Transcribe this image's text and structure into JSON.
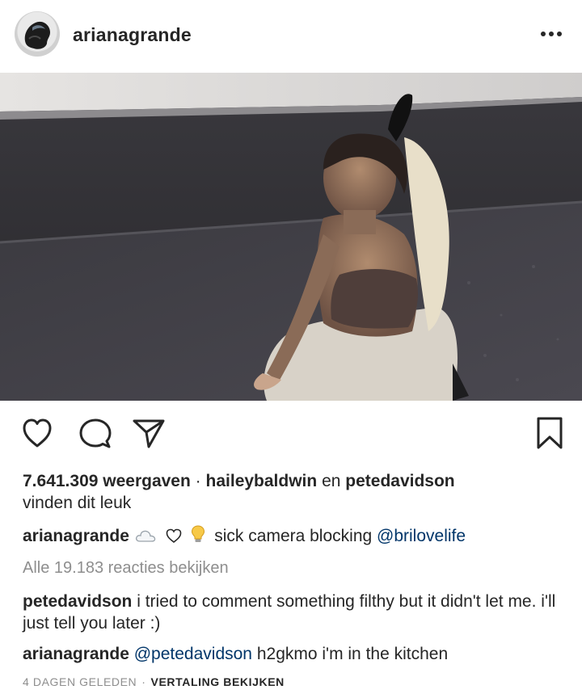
{
  "header": {
    "username": "arianagrande",
    "avatar_icon": "profile-photo",
    "more_icon": "more-horizontal-icon"
  },
  "media": {
    "type": "video-still"
  },
  "actions": {
    "like_icon": "heart-outline-icon",
    "comment_icon": "comment-bubble-icon",
    "share_icon": "paper-plane-icon",
    "save_icon": "bookmark-icon"
  },
  "stats": {
    "views": "7.641.309 weergaven",
    "separator": "·",
    "liker1": "haileybaldwin",
    "and_word": "en",
    "liker2": "petedavidson",
    "likes_suffix": "vinden dit leuk"
  },
  "caption": {
    "username": "arianagrande",
    "emoji_icons": [
      "cloud-icon",
      "heart-outline-icon",
      "lightbulb-icon"
    ],
    "text": "sick camera blocking",
    "mention": "@brilovelife"
  },
  "view_all_comments": "Alle 19.183 reacties bekijken",
  "comments": [
    {
      "username": "petedavidson",
      "text": "i tried to comment something filthy but it didn't let me. i'll just tell you later :)"
    },
    {
      "username": "arianagrande",
      "mention": "@petedavidson",
      "text": "h2gkmo i'm in the kitchen"
    }
  ],
  "footer": {
    "time": "4 DAGEN GELEDEN",
    "separator": "·",
    "translate": "VERTALING BEKIJKEN"
  },
  "colors": {
    "text": "#262626",
    "secondary": "#8e8e8e",
    "mention": "#003569"
  }
}
